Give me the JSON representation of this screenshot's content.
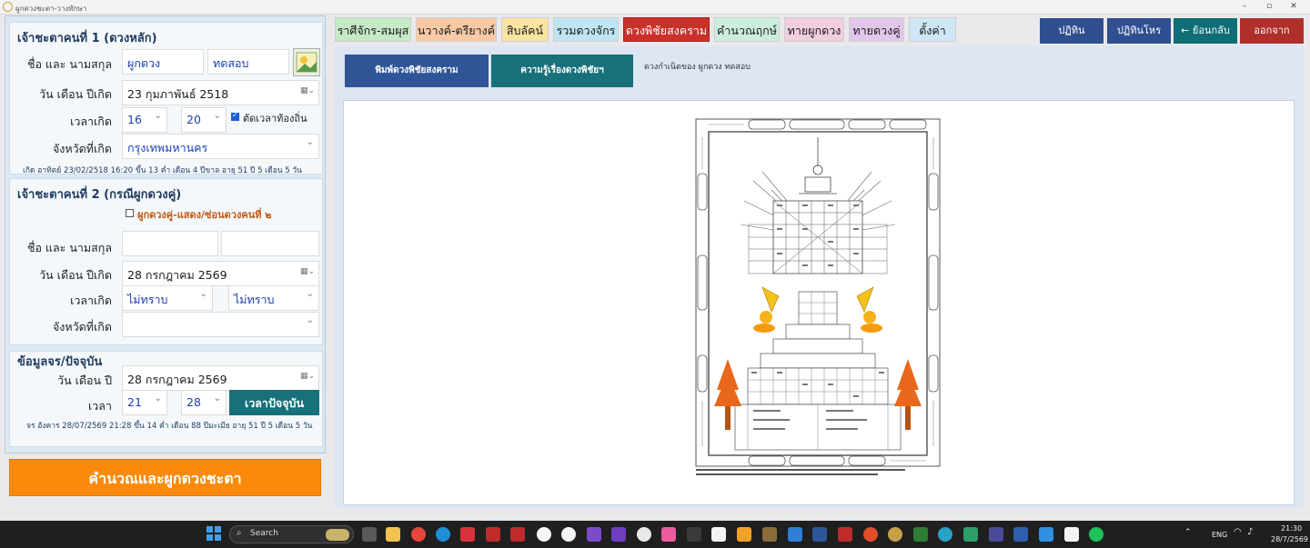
{
  "window": {
    "title": "ผูกดวงชะตา-วางทักษา"
  },
  "tabs": [
    {
      "label": "ราศีจักร-สมผุส",
      "color": "#c6e9c6"
    },
    {
      "label": "นวางค์-ตรียางค์",
      "color": "#f9c9a6"
    },
    {
      "label": "สิบลัคน์",
      "color": "#fbe3a1"
    },
    {
      "label": "รวมดวงจักร",
      "color": "#bfe5f3"
    },
    {
      "label": "ดวงพิชัยสงคราม",
      "color": "#c9312b"
    },
    {
      "label": "คำนวณฤกษ์",
      "color": "#cdeedf"
    },
    {
      "label": "ทายผูกดวง",
      "color": "#f3cde0"
    },
    {
      "label": "ทายดวงคู่",
      "color": "#e3c7ea"
    },
    {
      "label": "ตั้งค่า",
      "color": "#cfe7f4"
    }
  ],
  "right_buttons": [
    {
      "label": "ปฏิทิน",
      "color": "#2f4f91"
    },
    {
      "label": "ปฏิทินโหร",
      "color": "#2f4f91"
    },
    {
      "label": "← ย้อนกลับ",
      "color": "#0f6d76"
    },
    {
      "label": "ออกจาก",
      "color": "#b12f2b"
    }
  ],
  "person1": {
    "title": "เจ้าชะตาคนที่ 1 (ดวงหลัก)",
    "name_label": "ชื่อ และ นามสกุล",
    "first_name": "ผูกดวง",
    "last_name": "ทดสอบ",
    "date_label": "วัน เดือน ปีเกิด",
    "date": "23  กุมภาพันธ์    2518",
    "time_label": "เวลาเกิด",
    "hour": "16",
    "minute": "20",
    "local_time_label": "ตัดเวลาท้องถิ่น",
    "province_label": "จังหวัดที่เกิด",
    "province": "กรุงเทพมหานคร",
    "info": "เกิด อาทิตย์ 23/02/2518 16:20 ขึ้น 13 ค่ำ เดือน 4 ปีขาล อายุ 51 ปี 5 เดือน 5 วัน"
  },
  "person2": {
    "title": "เจ้าชะตาคนที่ 2 (กรณีผูกดวงคู่)",
    "toggle_label": "ผูกดวงคู่-แสดง/ซ่อนดวงคนที่ ๒",
    "name_label": "ชื่อ และ นามสกุล",
    "date_label": "วัน เดือน ปีเกิด",
    "date": "28  กรกฎาคม    2569",
    "time_label": "เวลาเกิด",
    "hour": "ไม่ทราบ",
    "minute": "ไม่ทราบ",
    "province_label": "จังหวัดที่เกิด"
  },
  "current": {
    "title": "ข้อมูลจร/ปัจจุบัน",
    "date_label": "วัน เดือน ปี",
    "date": "28  กรกฎาคม    2569",
    "time_label": "เวลา",
    "hour": "21",
    "minute": "28",
    "now_button": "เวลาปัจจุบัน",
    "info": "จร อังคาร 28/07/2569 21:28 ขึ้น 14 ค่ำ เดือน 88 ปีมะเมีย อายุ 51 ปี 5 เดือน 5 วัน"
  },
  "calc_button": "คำนวณและผูกดวงชะตา",
  "content": {
    "print_button": "พิมพ์ดวงพิชัยสงคราม",
    "knowledge_button": "ความรู้เรื่องดวงพิชัยฯ",
    "caption": "ดวงกำเนิดของ ผูกดวง ทดสอบ"
  },
  "taskbar": {
    "search_placeholder": "Search",
    "lang": "ENG",
    "time": "21:30",
    "date": "28/7/2569"
  }
}
